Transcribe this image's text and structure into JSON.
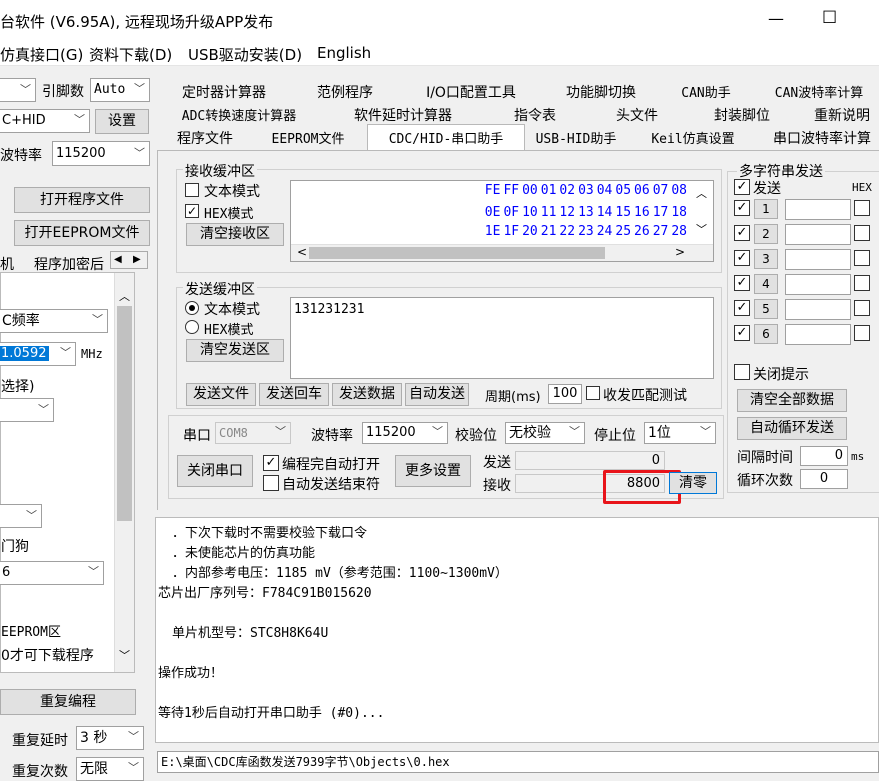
{
  "window": {
    "title": "台软件 (V6.95A), 远程现场升级APP发布",
    "minimize": "—",
    "maximize": "☐"
  },
  "menu": [
    "仿真接口(G)",
    "资料下载(D)",
    "USB驱动安装(D)",
    "English"
  ],
  "left": {
    "baud_label": "引脚数",
    "pin_value": "Auto",
    "port_value": "C+HID",
    "settings_button": "设置",
    "baudrate_label": "波特率",
    "baudrate_value": "115200",
    "open_prog_button": "打开程序文件",
    "open_eeprom_button": "打开EEPROM文件",
    "tab1": "机",
    "tab2": "程序加密后",
    "freq_label": "C频率",
    "freq_value": "1.0592",
    "freq_unit": "MHz",
    "select_label": "选择)",
    "watchdog_label": "门狗",
    "watchdog_value": "6",
    "eeprom_label": "EEPROM区",
    "download_label": "0才可下载程序",
    "reprogram_button": "重复编程",
    "repeat_delay_label": "重复延时",
    "repeat_delay_value": "3 秒",
    "repeat_count_label": "重复次数",
    "repeat_count_value": "无限"
  },
  "tabs": {
    "row1": [
      "定时器计算器",
      "范例程序",
      "I/O口配置工具",
      "功能脚切换",
      "CAN助手",
      "CAN波特率计算"
    ],
    "row2": [
      "ADC转换速度计算器",
      "软件延时计算器",
      "指令表",
      "头文件",
      "封装脚位",
      "重新说明"
    ],
    "row3": [
      "程序文件",
      "EEPROM文件",
      "CDC/HID-串口助手",
      "USB-HID助手",
      "Keil仿真设置",
      "串口波特率计算"
    ]
  },
  "receive": {
    "group_label": "接收缓冲区",
    "text_mode": "文本模式",
    "hex_mode": "HEX模式",
    "clear_button": "清空接收区",
    "hex_lines": [
      [
        "FE",
        "FF",
        "00",
        "01",
        "02",
        "03",
        "04",
        "05",
        "06",
        "07",
        "08"
      ],
      [
        "0E",
        "0F",
        "10",
        "11",
        "12",
        "13",
        "14",
        "15",
        "16",
        "17",
        "18"
      ],
      [
        "1E",
        "1F",
        "20",
        "21",
        "22",
        "23",
        "24",
        "25",
        "26",
        "27",
        "28"
      ]
    ]
  },
  "send": {
    "group_label": "发送缓冲区",
    "text_mode": "文本模式",
    "hex_mode": "HEX模式",
    "clear_button": "清空发送区",
    "content": "131231231",
    "send_file": "发送文件",
    "send_return": "发送回车",
    "send_data": "发送数据",
    "auto_send": "自动发送",
    "period_label": "周期(ms)",
    "period_value": "100",
    "match_test": "收发匹配测试"
  },
  "serial": {
    "port_label": "串口",
    "port_value": "COM8",
    "baud_label": "波特率",
    "baud_value": "115200",
    "parity_label": "校验位",
    "parity_value": "无校验",
    "stop_label": "停止位",
    "stop_value": "1位",
    "close_button": "关闭串口",
    "auto_open": "编程完自动打开",
    "auto_end": "自动发送结束符",
    "more_button": "更多设置",
    "tx_label": "发送",
    "tx_value": "0",
    "rx_label": "接收",
    "rx_value": "8800",
    "clear_button": "清零"
  },
  "multi": {
    "group_label": "多字符串发送",
    "send_label": "发送",
    "hex_label": "HEX",
    "rows": [
      "1",
      "2",
      "3",
      "4",
      "5",
      "6"
    ],
    "close_tip": "关闭提示",
    "clear_all": "清空全部数据",
    "auto_loop": "自动循环发送",
    "interval_label": "间隔时间",
    "interval_value": "0",
    "interval_unit": "ms",
    "loop_label": "循环次数",
    "loop_value": "0"
  },
  "log": [
    "．下次下载时不需要校验下载口令",
    "．未使能芯片的仿真功能",
    "．内部参考电压：1185 mV（参考范围：1100~1300mV）",
    "芯片出厂序列号：F784C91B015620",
    "",
    "单片机型号：STC8H8K64U",
    "",
    "操作成功！",
    "",
    "等待1秒后自动打开串口助手 (#0)..."
  ],
  "status_path": "E:\\桌面\\CDC库函数发送7939字节\\Objects\\0.hex",
  "colors": {
    "hex_blue": "#0000ff",
    "highlight_red": "#e8141a",
    "select_blue": "#0078d7"
  }
}
